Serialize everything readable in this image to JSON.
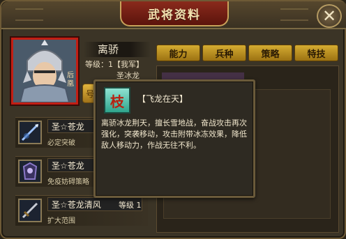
{
  "window": {
    "title": "武将资料",
    "close_label": "✕"
  },
  "general": {
    "name": "离骄",
    "level_label": "等级：1【我军】",
    "holy_label": "圣冰龙",
    "side_tag": "后凰",
    "gold_button_label": "号"
  },
  "tabs": [
    {
      "label": "能力"
    },
    {
      "label": "兵种"
    },
    {
      "label": "策略"
    },
    {
      "label": "特技"
    }
  ],
  "skills": [
    {
      "name": "圣☆苍龙",
      "level": "",
      "desc": "必定突破",
      "icon": "spear-icon"
    },
    {
      "name": "圣☆苍龙",
      "level": "",
      "desc": "免疫妨碍策略",
      "icon": "armor-icon"
    },
    {
      "name": "圣☆苍龙清风",
      "level": "等级 1",
      "desc": "扩大范围",
      "icon": "sword-icon"
    }
  ],
  "tooltip": {
    "icon_glyph": "枝",
    "title": "【飞龙在天】",
    "body": "离骄冰龙荆天，擅长雪地战，奋战攻击再次强化，突袭移动，攻击附带冰冻效果，降低敌人移动力，作战无往不利。"
  },
  "colors": {
    "accent_gold": "#d5ac32",
    "title_red": "#8a2a1c",
    "portrait_border": "#c21e14"
  }
}
